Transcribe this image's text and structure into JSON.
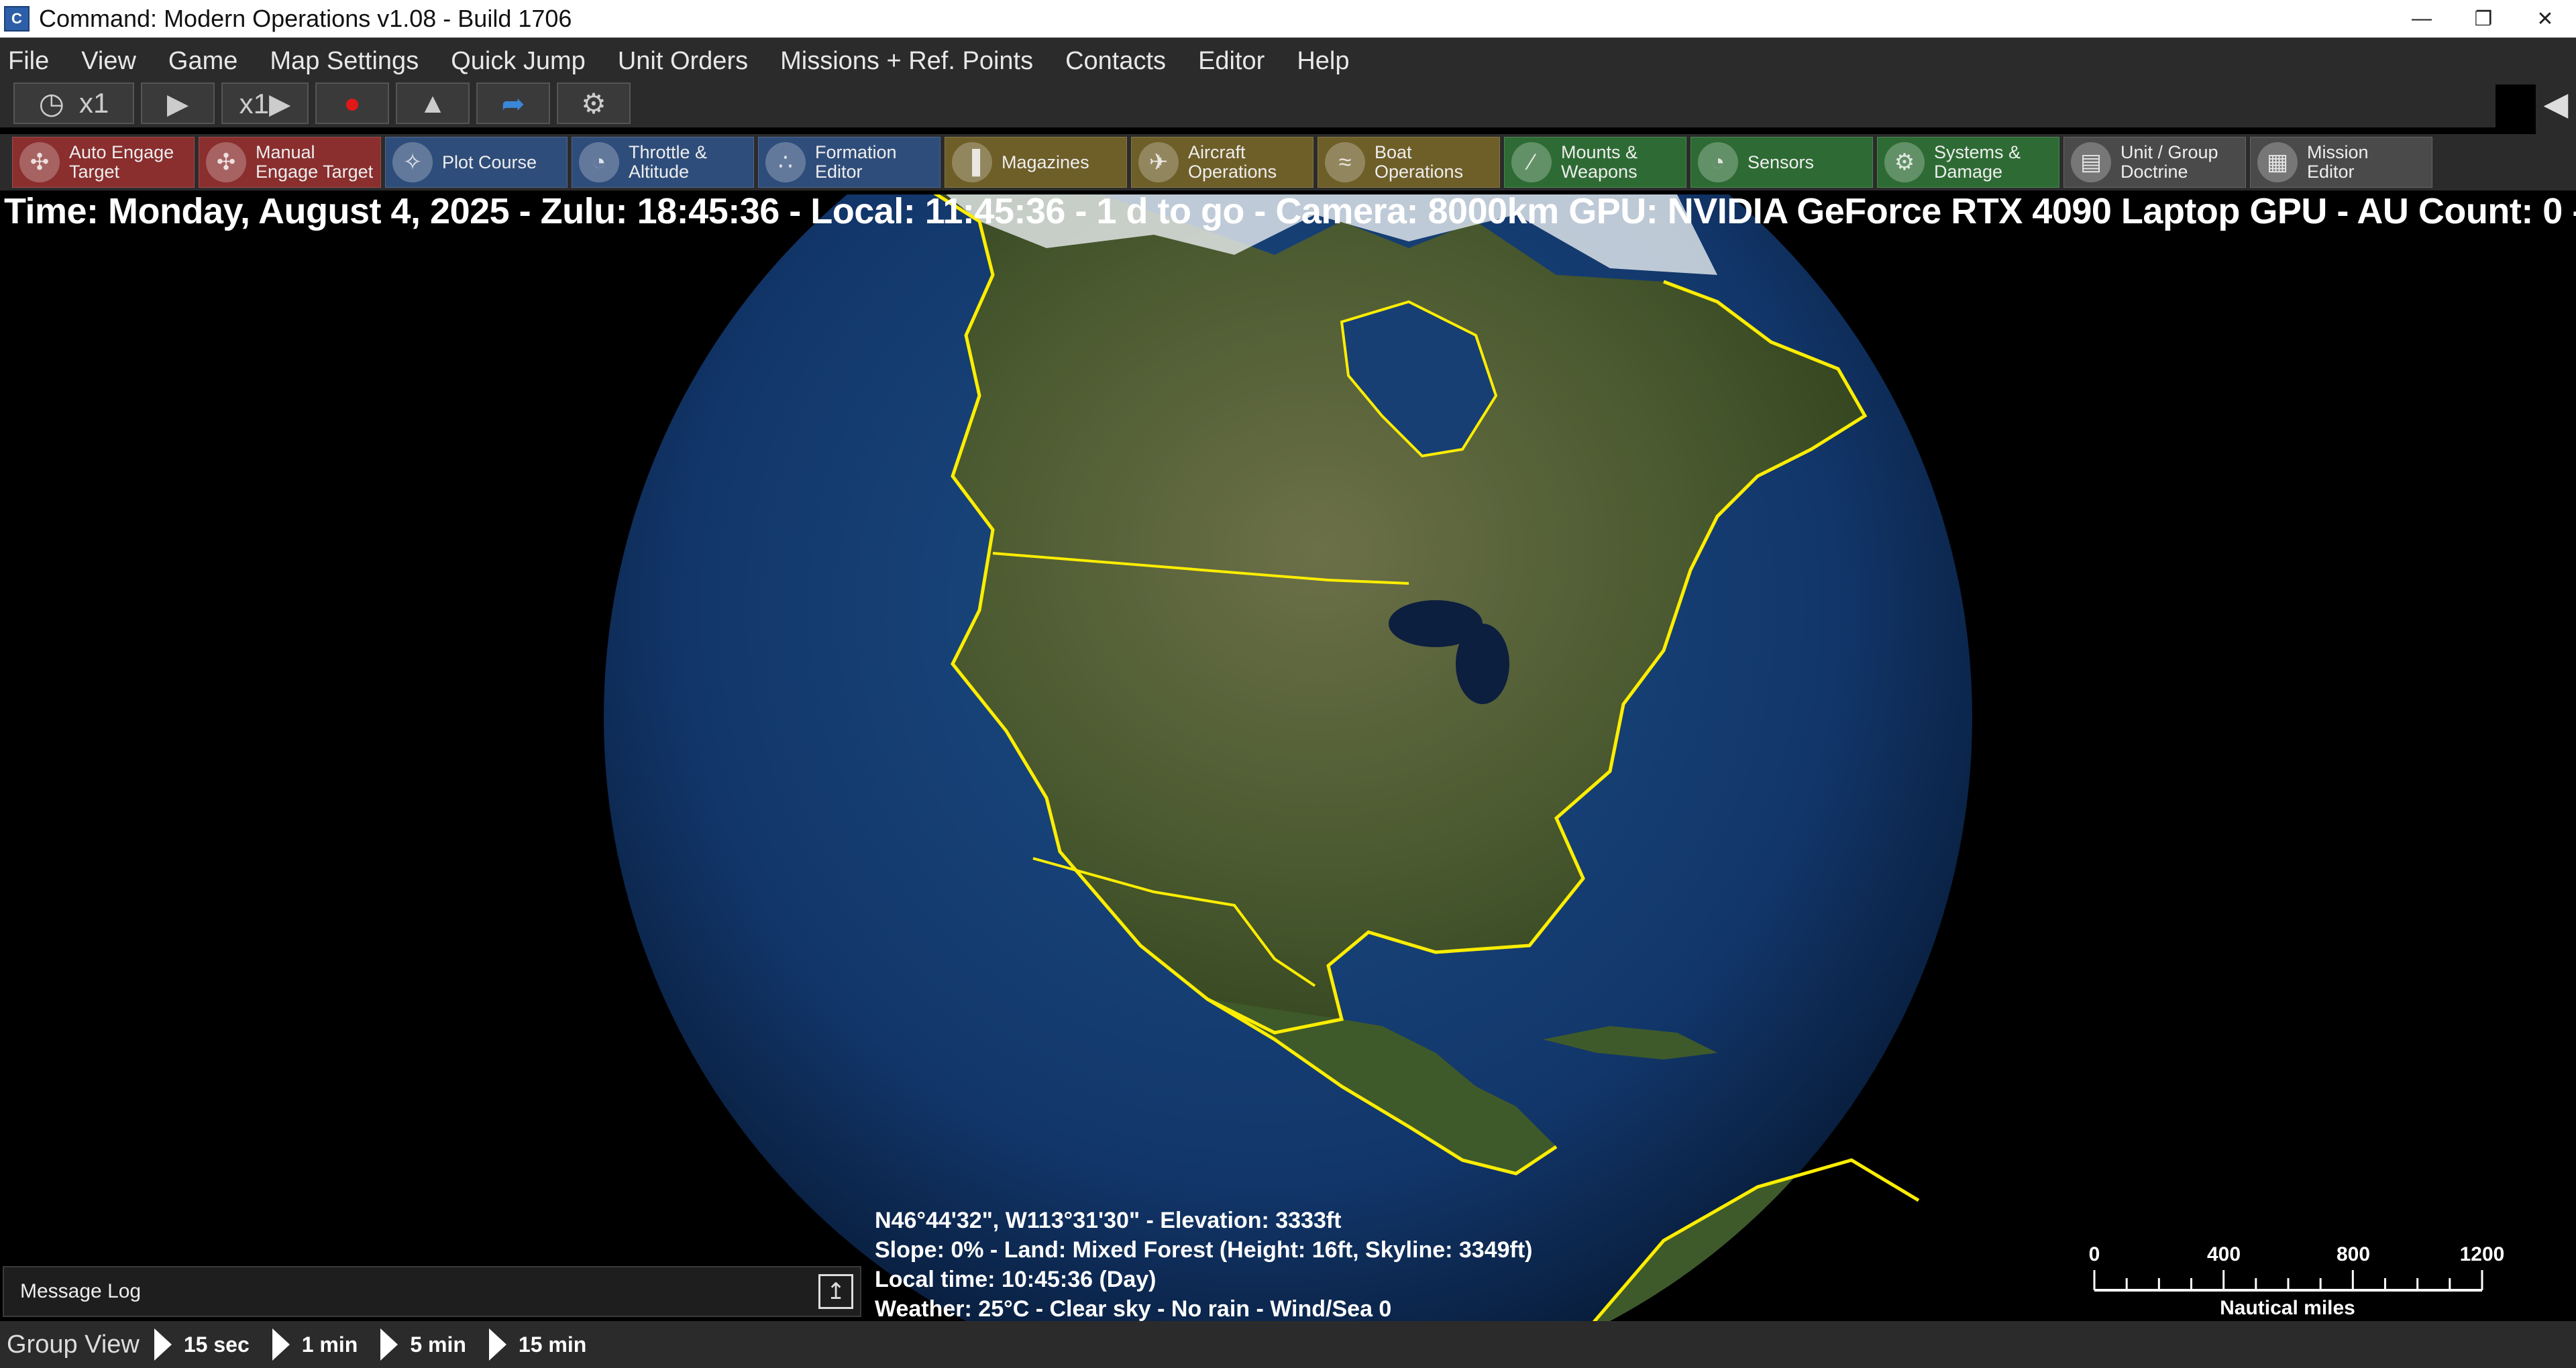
{
  "window": {
    "title": "Command: Modern Operations v1.08 - Build 1706",
    "icon_letter": "C",
    "minimize": "—",
    "restore": "❐",
    "close": "✕"
  },
  "menu": [
    "File",
    "View",
    "Game",
    "Map Settings",
    "Quick Jump",
    "Unit Orders",
    "Missions + Ref. Points",
    "Contacts",
    "Editor",
    "Help"
  ],
  "speedbar": {
    "clock_label": "x1",
    "speed_label": "x1▶"
  },
  "toolbar": [
    {
      "label": "Auto Engage\nTarget",
      "icon": "crosshair-icon",
      "color": "#8a2e2e",
      "glyph": "✣"
    },
    {
      "label": "Manual\nEngage Target",
      "icon": "crosshair-manual-icon",
      "color": "#8a2e2e",
      "glyph": "✣"
    },
    {
      "label": "Plot Course",
      "icon": "compass-icon",
      "color": "#2f4d7a",
      "glyph": "✧"
    },
    {
      "label": "Throttle &\nAltitude",
      "icon": "gauge-icon",
      "color": "#2f4d7a",
      "glyph": "◔"
    },
    {
      "label": "Formation\nEditor",
      "icon": "formation-icon",
      "color": "#2f4d7a",
      "glyph": "∴"
    },
    {
      "label": "Magazines",
      "icon": "ammo-icon",
      "color": "#6e5e28",
      "glyph": "▐"
    },
    {
      "label": "Aircraft\nOperations",
      "icon": "aircraft-icon",
      "color": "#6e5e28",
      "glyph": "✈"
    },
    {
      "label": "Boat\nOperations",
      "icon": "boat-icon",
      "color": "#6e5e28",
      "glyph": "≈"
    },
    {
      "label": "Mounts &\nWeapons",
      "icon": "weapons-icon",
      "color": "#2e6b34",
      "glyph": "∕"
    },
    {
      "label": "Sensors",
      "icon": "radar-icon",
      "color": "#2e6b34",
      "glyph": "◔"
    },
    {
      "label": "Systems &\nDamage",
      "icon": "gear-damage-icon",
      "color": "#2e6b34",
      "glyph": "⚙"
    },
    {
      "label": "Unit / Group\nDoctrine",
      "icon": "document-icon",
      "color": "#4a4a4a",
      "glyph": "▤"
    },
    {
      "label": "Mission\nEditor",
      "icon": "mission-editor-icon",
      "color": "#4a4a4a",
      "glyph": "▦"
    }
  ],
  "status_line": "Time: Monday, August 4, 2025 - Zulu: 18:45:36 - Local: 11:45:36 - 1 d to go - Camera: 8000km GPU: NVIDIA GeForce RTX 4090 Laptop GPU - AU Count: 0 -",
  "cursor_info": [
    "N46°44'32\", W113°31'30\" - Elevation: 3333ft",
    "Slope: 0%  - Land: Mixed Forest (Height: 16ft, Skyline: 3349ft)",
    "Local time: 10:45:36 (Day)",
    "Weather: 25°C - Clear sky - No rain - Wind/Sea 0"
  ],
  "message_log": {
    "title": "Message Log"
  },
  "scale": {
    "ticks": [
      "0",
      "400",
      "800",
      "1200"
    ],
    "unit": "Nautical miles"
  },
  "bottombar": {
    "group_view": "Group View",
    "steps": [
      "15 sec",
      "1 min",
      "5 min",
      "15 min"
    ]
  },
  "colors": {
    "coastline": "#ffee00",
    "ocean": "#0f2c5a",
    "land": "#5a6a3a"
  }
}
